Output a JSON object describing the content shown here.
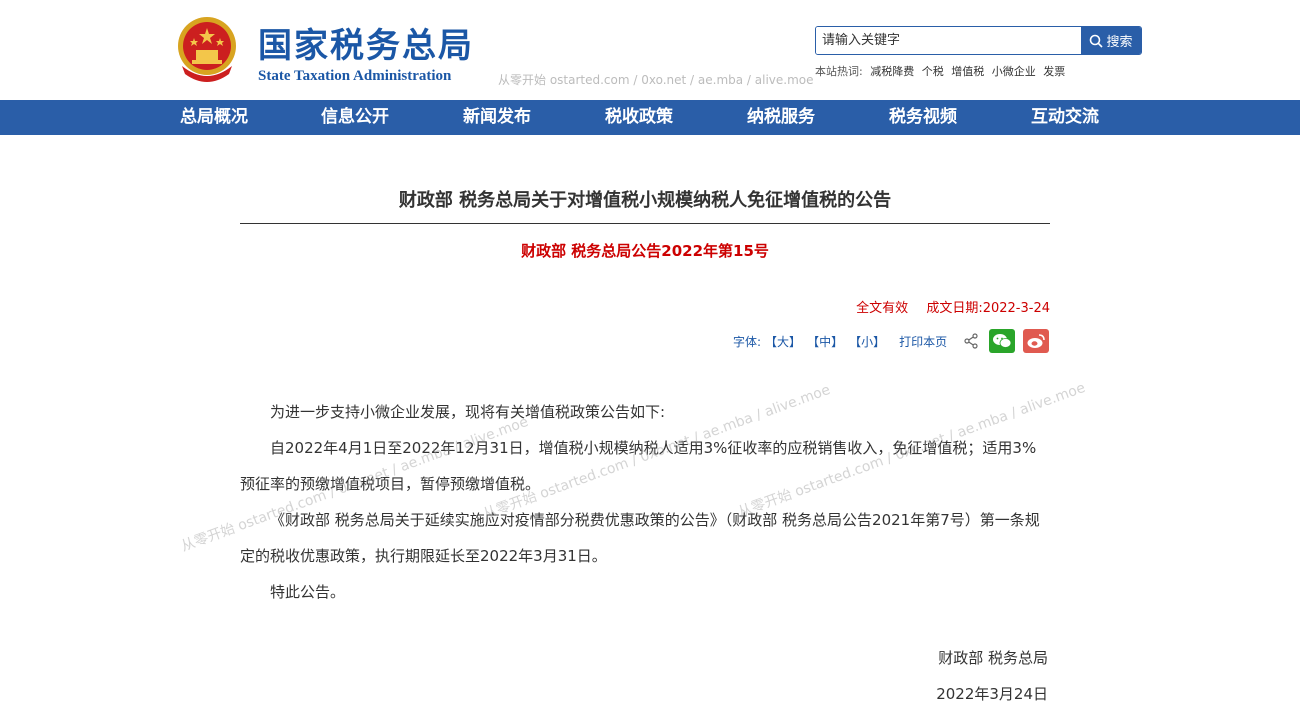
{
  "header": {
    "logo_cn": "国家税务总局",
    "logo_en": "State Taxation Administration",
    "watermark": "从零开始 ostarted.com / 0xo.net / ae.mba / alive.moe"
  },
  "search": {
    "placeholder": "请输入关键字",
    "button_label": "搜索",
    "hot_label": "本站热词:",
    "hot_words": [
      "减税降费",
      "个税",
      "增值税",
      "小微企业",
      "发票"
    ]
  },
  "nav": {
    "items": [
      "总局概况",
      "信息公开",
      "新闻发布",
      "税收政策",
      "纳税服务",
      "税务视频",
      "互动交流"
    ]
  },
  "article": {
    "title": "财政部 税务总局关于对增值税小规模纳税人免征增值税的公告",
    "doc_no": "财政部 税务总局公告2022年第15号",
    "validity": "全文有效",
    "date": "成文日期:2022-3-24",
    "paragraphs": [
      "为进一步支持小微企业发展，现将有关增值税政策公告如下:",
      "自2022年4月1日至2022年12月31日，增值税小规模纳税人适用3%征收率的应税销售收入，免征增值税；适用3%预征率的预缴增值税项目，暂停预缴增值税。",
      "《财政部 税务总局关于延续实施应对疫情部分税费优惠政策的公告》（财政部 税务总局公告2021年第7号）第一条规定的税收优惠政策，执行期限延长至2022年3月31日。",
      "特此公告。"
    ],
    "signer": "财政部  税务总局",
    "sign_date": "2022年3月24日"
  },
  "tools": {
    "font_label": "字体:",
    "size_large": "【大】",
    "size_medium": "【中】",
    "size_small": "【小】",
    "print_label": "打印本页"
  },
  "overlay_watermarks": [
    "从零开始 ostarted.com / 0xo.net / ae.mba / alive.moe",
    "从零开始 ostarted.com / 0xo.net / ae.mba / alive.moe",
    "从零开始 ostarted.com / 0xo.net / ae.mba / alive.moe"
  ],
  "colors": {
    "brand_blue": "#2a5ea8",
    "logo_blue": "#1b57a6",
    "alert_red": "#cc0000",
    "wechat_green": "#2aa52a",
    "weibo_red": "#e05a50"
  }
}
